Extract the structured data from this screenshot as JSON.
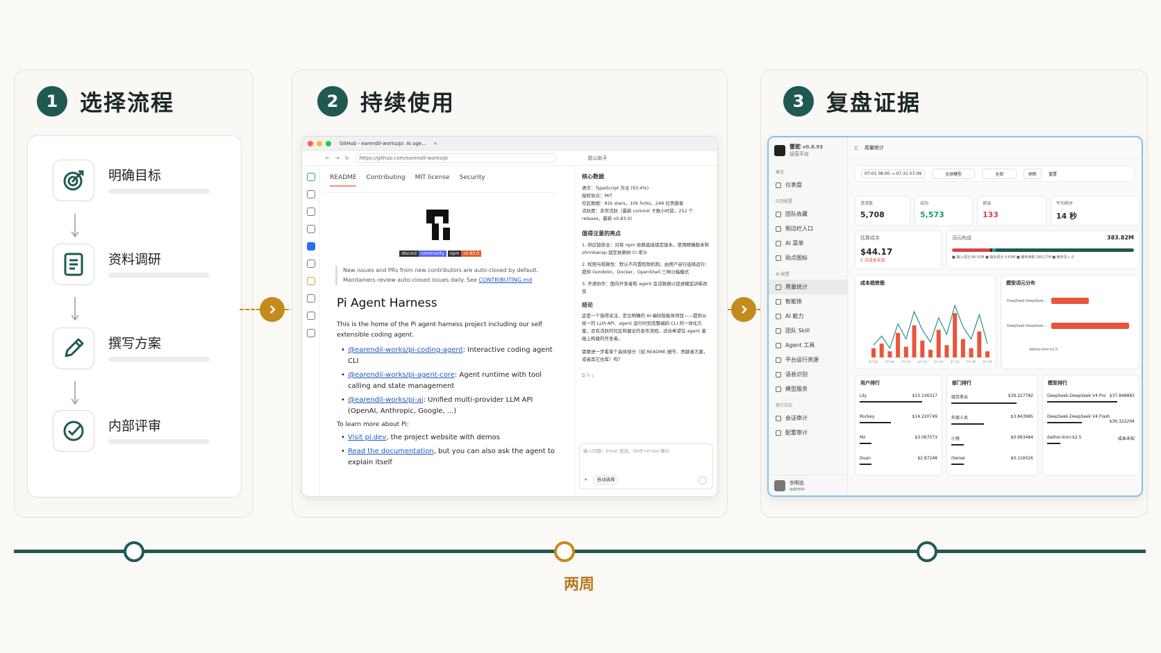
{
  "steps": [
    {
      "num": "1",
      "title": "选择流程"
    },
    {
      "num": "2",
      "title": "持续使用"
    },
    {
      "num": "3",
      "title": "复盘证据"
    }
  ],
  "flow": [
    {
      "label": "明确目标",
      "icon": "target-icon"
    },
    {
      "label": "资料调研",
      "icon": "document-icon"
    },
    {
      "label": "撰写方案",
      "icon": "pencil-icon"
    },
    {
      "label": "内部评审",
      "icon": "check-circle-icon"
    }
  ],
  "browser": {
    "tab_title": "GitHub - earendil-works/pi: AI age...",
    "url": "https://github.com/earendil-works/pi",
    "assistant_placeholder": "题以助手",
    "readme_tabs": [
      "README",
      "Contributing",
      "MIT license",
      "Security"
    ],
    "badge_discord": "discord",
    "badge_community": "community",
    "badge_npm": "npm",
    "badge_version": "v0.83.0",
    "notice": "New issues and PRs from new contributors are auto-closed by default. Maintainers review auto-closed issues daily. See",
    "notice_link": "CONTRIBUTING.md",
    "heading": "Pi Agent Harness",
    "intro": "This is the home of the Pi agent harness project including our self extensible coding agent.",
    "packages": [
      {
        "link": "@earendil-works/pi-coding-agent",
        "desc": ": Interactive coding agent CLI"
      },
      {
        "link": "@earendil-works/pi-agent-core",
        "desc": ": Agent runtime with tool calling and state management"
      },
      {
        "link": "@earendil-works/pi-ai",
        "desc": ": Unified multi-provider LLM API (OpenAI, Anthropic, Google, ...)"
      }
    ],
    "learn_more": "To learn more about Pi:",
    "learn_links": [
      {
        "link": "Visit pi.dev",
        "desc": ", the project website with demos"
      },
      {
        "link": "Read the documentation",
        "desc": ", but you can also ask the agent to explain itself"
      }
    ],
    "side": {
      "core_title": "核心数据",
      "core_items": [
        "语言：TypeScript 为主 (93.4%)",
        "授权协议：MIT",
        "社区数据：81k stars，10k forks，248 位贡献者",
        "活跃度：非常活跃（最新 commit 于数小时前，252 个 release，最新 v0.83.0）"
      ],
      "notes_title": "值得注意的亮点",
      "notes": [
        "1. 供应链安全：对将 npm 依赖直接锁定版本，使用精确版本和 shrinkwrap 锁定依赖树 CI 审计",
        "2. 权限与隔离性：默认不内置权限机制，由用户自行选择运行：提供 Gondolin、Docker、OpenShell 三种沙箱模式",
        "3. 开源协作：面向开发者和 agent 会话数据以促进模型训练改良"
      ],
      "conclusion_title": "结论",
      "conclusion": "这是一个值得关注、定位明确的 AI 编码智能体项目——提供从统一的 LLM API、agent 运行时到完整编码 CLI 的一体化方案，且有活跃的社区和健全的发布流程。适合希望在 agent 基础上构建的开发者。",
      "followup": "需要进一步看某个具体部分（如 README 细节、贡献者方案，或者其它仓库）吗？",
      "input_placeholder": "输入问题，Enter 发送，Shift+Enter 换行",
      "mode": "自动选择"
    }
  },
  "dashboard": {
    "app_name": "雷驼",
    "version": "v0.8.93",
    "subtitle": "运营平台",
    "page_title": "用量统计",
    "date_range": "07-01 08:00 → 07-31 07:09",
    "model_filter": "全部模型",
    "scope_filter": "全部",
    "refresh": "刷新",
    "reset": "重置",
    "nav_sections": [
      {
        "title": "概览",
        "items": [
          "仪表盘"
        ]
      },
      {
        "title": "应用配置",
        "items": [
          "团队收藏",
          "侧边栏入口",
          "AI 菜单",
          "贴点图标"
        ]
      },
      {
        "title": "AI 配置",
        "items": [
          "用量统计",
          "智能体",
          "AI 能力",
          "团队 Skill",
          "Agent 工具",
          "平台运行资源",
          "语音识别",
          "模型服务"
        ]
      },
      {
        "title": "审计日志",
        "items": [
          "会话审计",
          "配置审计"
        ]
      }
    ],
    "user": {
      "name": "衣明志",
      "role": "admin"
    },
    "stats": [
      {
        "label": "请求数",
        "value": "5,708",
        "color": "#222222"
      },
      {
        "label": "成功",
        "value": "5,573",
        "color": "#1a9a72"
      },
      {
        "label": "错误",
        "value": "133",
        "color": "#d64545"
      },
      {
        "label": "平均耗时",
        "value": "14 秒",
        "color": "#222222"
      }
    ],
    "cost": {
      "label": "估算成本",
      "value": "$44.17",
      "note": "5 次成本未知"
    },
    "tokens": {
      "label": "词元构成",
      "value": "383.82M",
      "legend": "■ 输入词元 80.02M  ■ 输出词元 4.63M  ■ 缓存读取 290.17M  ■ 缓存写入 0"
    },
    "trend_title": "成本趋势图",
    "model_dist_title": "模型词元分布",
    "model_dist": [
      {
        "name": "DeepSeek-DeepSeek...",
        "value": 0.45
      },
      {
        "name": "DeepSeek-DeepSeek...",
        "value": 0.93
      },
      {
        "name": "dathor-kimi-k2.5",
        "value": 0.0
      }
    ],
    "chart_data": {
      "type": "line",
      "title": "成本趋势图",
      "x": [
        "07-02",
        "07-04",
        "07-06",
        "07-08",
        "07-10",
        "07-12",
        "07-14",
        "07-16",
        "07-18",
        "07-20",
        "07-22",
        "07-24",
        "07-26",
        "07-28",
        "07-30"
      ],
      "series": [
        {
          "values": [
            8,
            14,
            6,
            22,
            12,
            30,
            18,
            10,
            26,
            15,
            34,
            20,
            12,
            28,
            9
          ]
        }
      ],
      "bars": [
        6,
        9,
        4,
        16,
        7,
        21,
        11,
        5,
        18,
        8,
        29,
        12,
        6,
        17,
        4
      ],
      "ylim": [
        0,
        40
      ]
    },
    "rank_user_title": "用户排行",
    "rank_user": [
      {
        "name": "Lily",
        "value": "$15.136317"
      },
      {
        "name": "Rockey",
        "value": "$14.220749"
      },
      {
        "name": "Mz",
        "value": "$3.067073"
      },
      {
        "name": "Duan",
        "value": "$2.87248"
      }
    ],
    "rank_dept_title": "部门排行",
    "rank_dept": [
      {
        "name": "组合务云",
        "value": "$39.227782"
      },
      {
        "name": "外部人员",
        "value": "$3.843985"
      },
      {
        "name": "小悦",
        "value": "$0.993484"
      },
      {
        "name": "iSense",
        "value": "$0.116026"
      }
    ],
    "rank_model_title": "模型排行",
    "rank_model": [
      {
        "name": "DeepSeek-DeepSeek V4 Pro",
        "value": "$37.848883"
      },
      {
        "name": "DeepSeek-DeepSeek V4 Flash",
        "value": "$36.322294"
      },
      {
        "name": "dathor-kimi-k2.5",
        "value": "成本未知"
      }
    ]
  },
  "period": "两周"
}
